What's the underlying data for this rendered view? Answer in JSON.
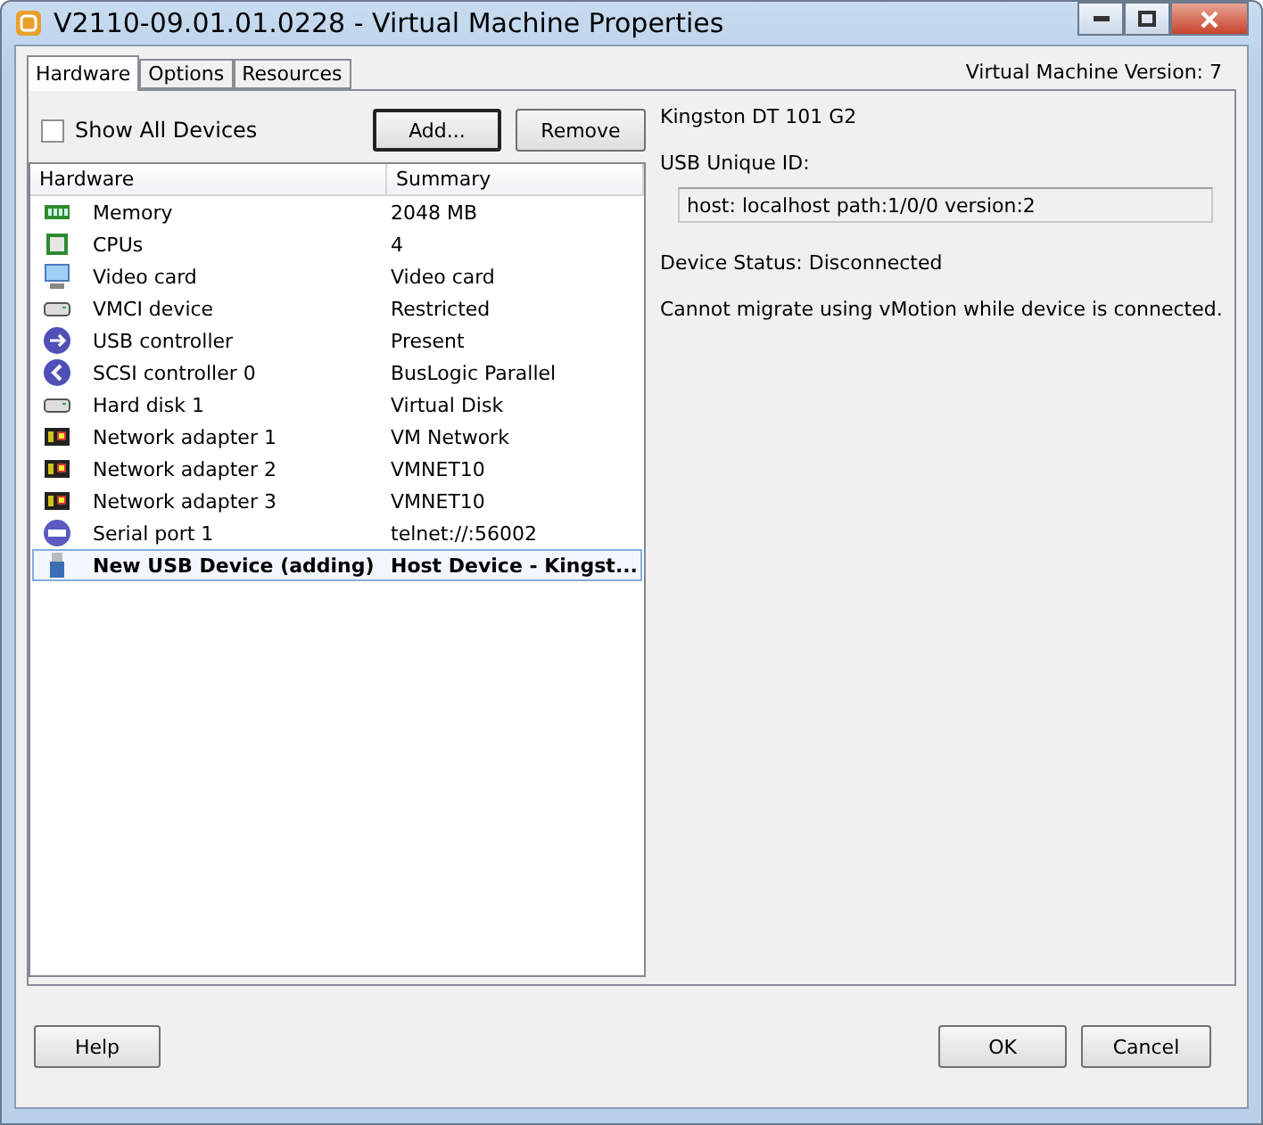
{
  "window": {
    "title": "V2110-09.01.01.0228 - Virtual Machine Properties"
  },
  "tabs": [
    {
      "label": "Hardware",
      "selected": true
    },
    {
      "label": "Options",
      "selected": false
    },
    {
      "label": "Resources",
      "selected": false
    }
  ],
  "version_label": "Virtual Machine Version: 7",
  "show_all_devices": {
    "label": "Show All Devices",
    "checked": false
  },
  "buttons": {
    "add": "Add...",
    "remove": "Remove"
  },
  "table": {
    "columns": [
      "Hardware",
      "Summary"
    ],
    "rows": [
      {
        "kind": "memory",
        "hardware": "Memory",
        "summary": "2048 MB",
        "selected": false
      },
      {
        "kind": "cpu",
        "hardware": "CPUs",
        "summary": "4",
        "selected": false
      },
      {
        "kind": "display",
        "hardware": "Video card",
        "summary": "Video card",
        "selected": false
      },
      {
        "kind": "device",
        "hardware": "VMCI device",
        "summary": "Restricted",
        "selected": false
      },
      {
        "kind": "usbcontroller",
        "hardware": "USB controller",
        "summary": "Present",
        "selected": false
      },
      {
        "kind": "controller",
        "hardware": "SCSI controller 0",
        "summary": "BusLogic Parallel",
        "selected": false
      },
      {
        "kind": "device",
        "hardware": "Hard disk 1",
        "summary": "Virtual Disk",
        "selected": false
      },
      {
        "kind": "network",
        "hardware": "Network adapter 1",
        "summary": "VM Network",
        "selected": false
      },
      {
        "kind": "network",
        "hardware": "Network adapter 2",
        "summary": "VMNET10",
        "selected": false
      },
      {
        "kind": "network",
        "hardware": "Network adapter 3",
        "summary": "VMNET10",
        "selected": false
      },
      {
        "kind": "serial",
        "hardware": "Serial port 1",
        "summary": "telnet://:56002",
        "selected": false
      },
      {
        "kind": "usb",
        "hardware": "New USB Device (adding)",
        "summary": "Host Device - Kingst...",
        "selected": true
      }
    ]
  },
  "details": {
    "device_name": "Kingston DT 101 G2",
    "id_label": "USB Unique ID:",
    "id_value": "host: localhost path:1/0/0 version:2",
    "status": "Device Status: Disconnected",
    "note": "Cannot migrate using vMotion while device is connected."
  },
  "footer": {
    "help": "Help",
    "ok": "OK",
    "cancel": "Cancel"
  }
}
